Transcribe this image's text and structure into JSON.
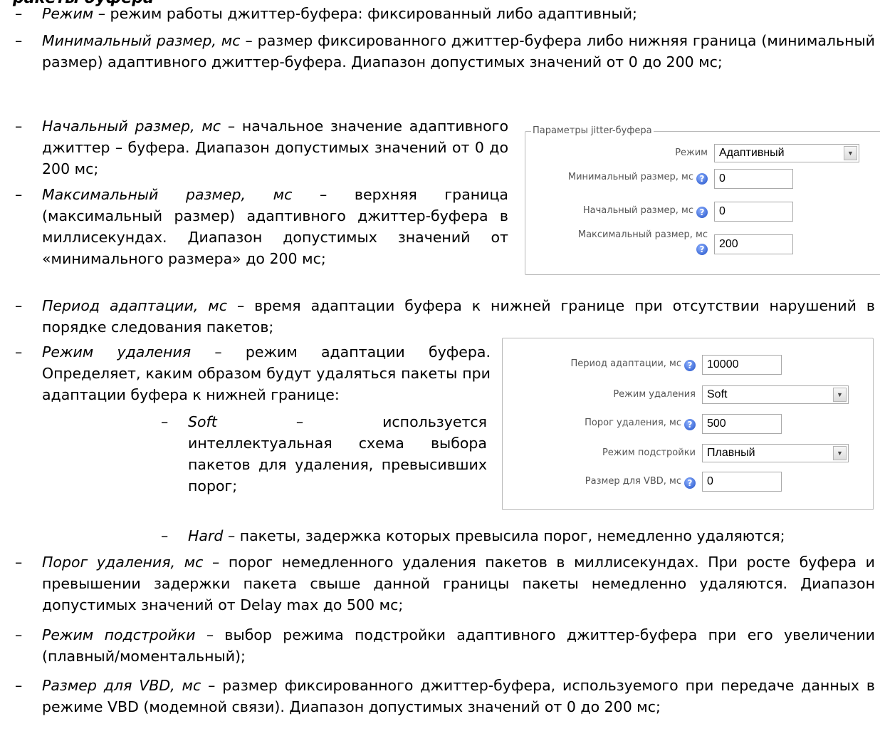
{
  "heading": "ракеты буфера",
  "top_items": [
    {
      "term": "Режим",
      "text": " – режим работы джиттер-буфера: фиксированный либо адаптивный;"
    },
    {
      "term": "Минимальный размер, мс",
      "text": " – размер фиксированного джиттер-буфера либо нижняя граница (минимальный размер) адаптивного джиттер-буфера. Диапазон допустимых значений от 0 до 200 мс;"
    },
    {
      "term": "Начальный размер, мс",
      "text": " – начальное значение адаптивного джиттер – буфера. Диапазон допустимых значений от 0 до 200 мс;"
    },
    {
      "term": "Максимальный размер, мс",
      "text": " – верхняя граница (максимальный размер) адаптивного джиттер-буфера в миллисекундах. Диапазон допустимых значений от «минимального размера» до 200 мс;"
    }
  ],
  "middle_items": [
    {
      "term": "Период адаптации, мс",
      "text": " – время адаптации буфера к нижней границе при отсутствии нарушений в порядке следования пакетов;"
    },
    {
      "term": "Режим удаления",
      "text": " – режим адаптации буфера. Определяет, каким образом будут удаляться пакеты при адаптации буфера к нижней границе:"
    }
  ],
  "sub_items": [
    {
      "term": "Soft",
      "text": " – используется интеллектуальная схема выбора пакетов для удаления, превысивших порог;"
    },
    {
      "term": "Hard",
      "text": " – пакеты, задержка которых превысила порог, немедленно удаляются;"
    }
  ],
  "bottom_items": [
    {
      "term": "Порог удаления, мс",
      "text": " – порог немедленного удаления пакетов в миллисекундах. При росте буфера и превышении задержки пакета свыше данной границы пакеты немедленно удаляются. Диапазон допустимых значений от Delay max до 500 мс;"
    },
    {
      "term": "Режим подстройки",
      "text": " – выбор режима подстройки адаптивного джиттер-буфера при его увеличении (плавный/моментальный);"
    },
    {
      "term": "Размер для VBD, мс",
      "text": " – размер фиксированного джиттер-буфера, используемого при передаче данных в режиме VBD (модемной связи). Диапазон допустимых значений от 0 до 200 мс;"
    }
  ],
  "panel1": {
    "legend": "Параметры jitter-буфера",
    "mode_label": "Режим",
    "mode_value": "Адаптивный",
    "min_label": "Минимальный размер, мс",
    "min_value": "0",
    "start_label": "Начальный размер, мс",
    "start_value": "0",
    "max_label": "Максимальный размер, мс",
    "max_value": "200"
  },
  "panel2": {
    "period_label": "Период адаптации, мс",
    "period_value": "10000",
    "delete_mode_label": "Режим удаления",
    "delete_mode_value": "Soft",
    "threshold_label": "Порог удаления, мс",
    "threshold_value": "500",
    "tune_mode_label": "Режим подстройки",
    "tune_mode_value": "Плавный",
    "vbd_label": "Размер для VBD, мс",
    "vbd_value": "0"
  },
  "icons": {
    "help": "help-question-icon",
    "dropdown": "chevron-down-icon",
    "bullet": "dash-bullet"
  },
  "help_glyph": "?",
  "dash_glyph": "–",
  "arrow_glyph": "▼"
}
